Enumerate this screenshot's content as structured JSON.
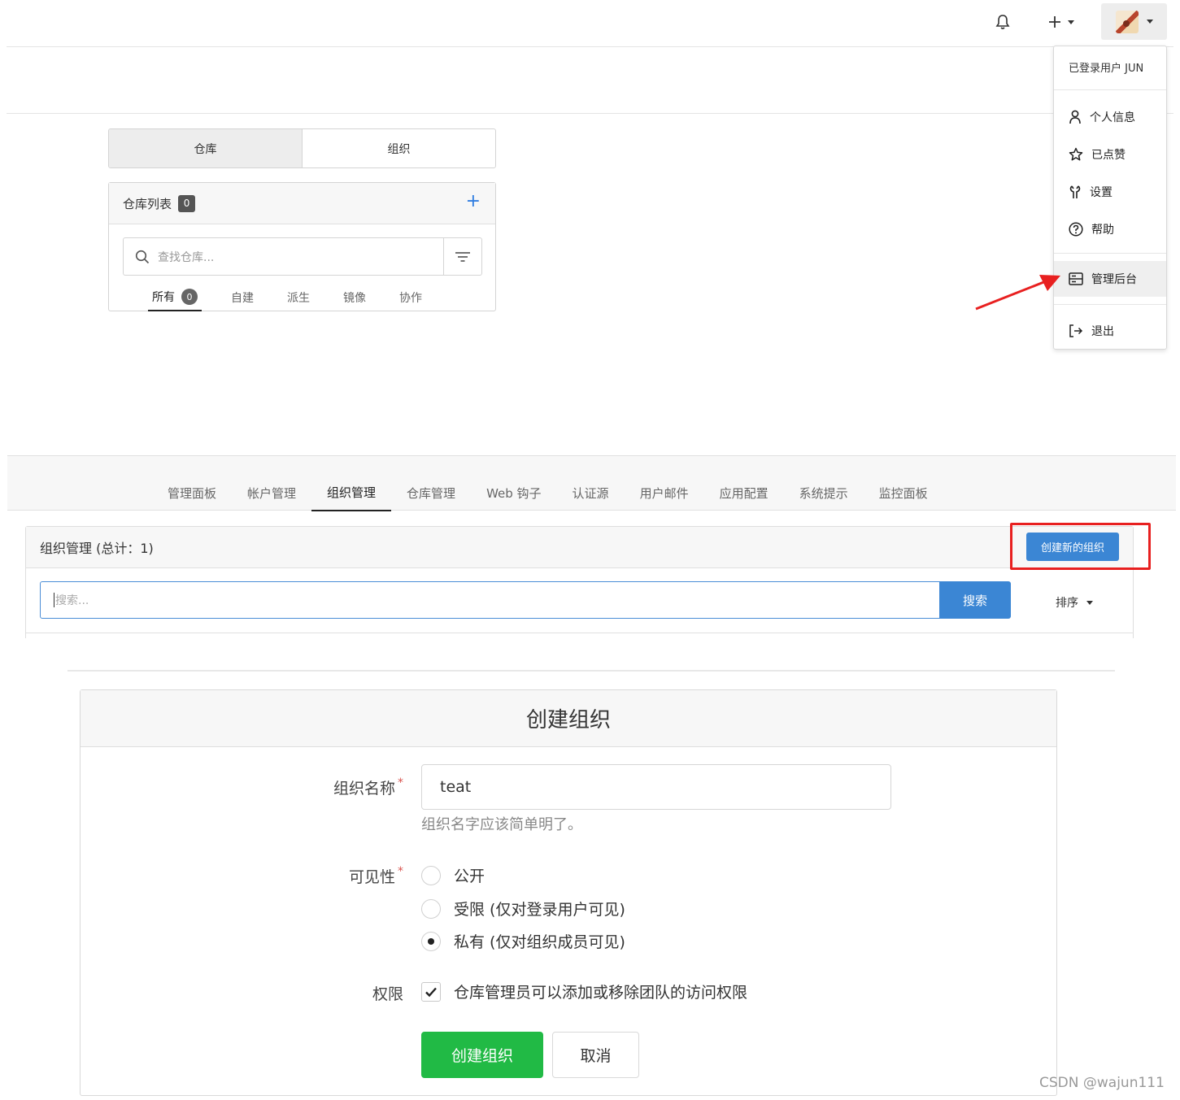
{
  "navbar": {
    "bell_icon": "bell-icon",
    "plus_icon": "plus-icon",
    "avatar_icon": "avatar-image"
  },
  "user_menu": {
    "header": "已登录用户 JUN",
    "items": [
      {
        "label": "个人信息",
        "icon": "user-icon"
      },
      {
        "label": "已点赞",
        "icon": "star-icon"
      },
      {
        "label": "设置",
        "icon": "wrench-icon"
      },
      {
        "label": "帮助",
        "icon": "question-circle-icon"
      },
      {
        "label": "管理后台",
        "icon": "server-icon"
      },
      {
        "label": "退出",
        "icon": "sign-out-icon"
      }
    ]
  },
  "dashboard": {
    "tabs": [
      "仓库",
      "组织"
    ],
    "repo_list_title": "仓库列表",
    "repo_count": "0",
    "search_placeholder": "查找仓库...",
    "filter_tabs": [
      {
        "label": "所有",
        "count": "0"
      },
      {
        "label": "自建"
      },
      {
        "label": "派生"
      },
      {
        "label": "镜像"
      },
      {
        "label": "协作"
      }
    ]
  },
  "admin": {
    "tabs": [
      "管理面板",
      "帐户管理",
      "组织管理",
      "仓库管理",
      "Web 钩子",
      "认证源",
      "用户邮件",
      "应用配置",
      "系统提示",
      "监控面板"
    ],
    "active_tab": "组织管理",
    "org_header": "组织管理 (总计：1)",
    "create_org_button": "创建新的组织",
    "search_placeholder": "搜索...",
    "search_button": "搜索",
    "sort_label": "排序"
  },
  "create_org_form": {
    "title": "创建组织",
    "name_label": "组织名称",
    "name_value": "teat",
    "name_help": "组织名字应该简单明了。",
    "visibility_label": "可见性",
    "visibility_options": [
      "公开",
      "受限 (仅对登录用户可见)",
      "私有 (仅对组织成员可见)"
    ],
    "visibility_selected": "私有 (仅对组织成员可见)",
    "permission_label": "权限",
    "permission_checkbox": "仓库管理员可以添加或移除团队的访问权限",
    "permission_checked": true,
    "submit_button": "创建组织",
    "cancel_button": "取消"
  },
  "watermark": "CSDN @wajun111",
  "colors": {
    "primary_blue": "#3b86d4",
    "success_green": "#21ba45",
    "highlight_red": "#e82020"
  }
}
